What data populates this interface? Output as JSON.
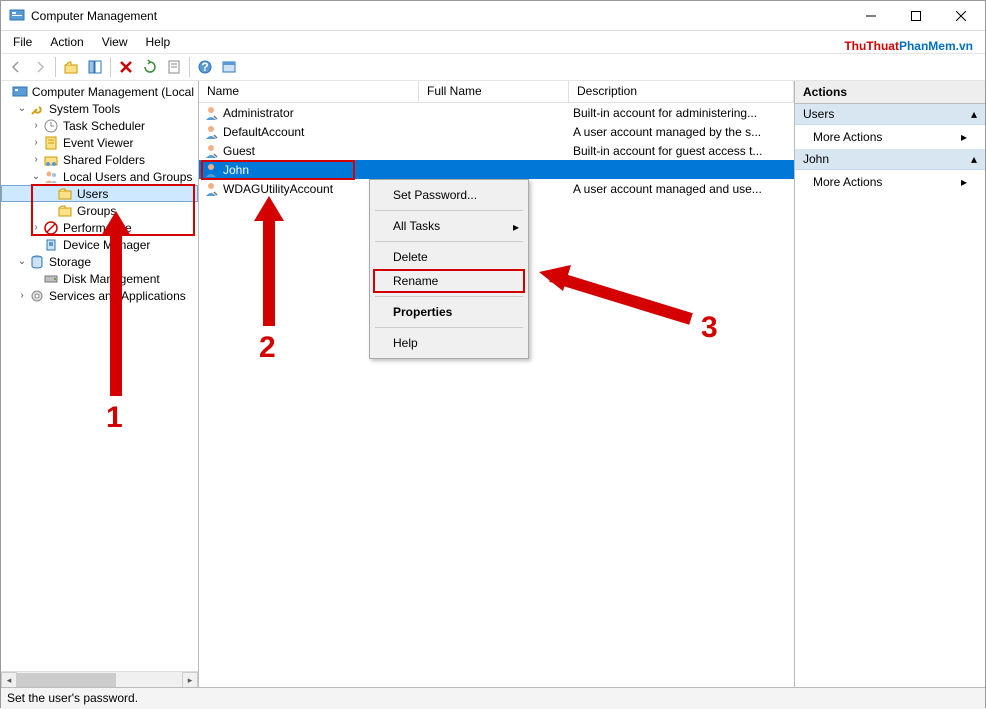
{
  "title": "Computer Management",
  "menus": [
    "File",
    "Action",
    "View",
    "Help"
  ],
  "watermark": {
    "part1": "ThuThuat",
    "part2": "PhanMem",
    "part3": ".vn"
  },
  "tree": {
    "root": "Computer Management (Local",
    "system_tools": "System Tools",
    "task_scheduler": "Task Scheduler",
    "event_viewer": "Event Viewer",
    "shared_folders": "Shared Folders",
    "local_users_groups": "Local Users and Groups",
    "users": "Users",
    "groups": "Groups",
    "performance": "Performance",
    "device_manager": "Device Manager",
    "storage": "Storage",
    "disk_management": "Disk Management",
    "services_apps": "Services and Applications"
  },
  "columns": {
    "name": "Name",
    "fullname": "Full Name",
    "description": "Description"
  },
  "users": [
    {
      "name": "Administrator",
      "fullname": "",
      "desc": "Built-in account for administering..."
    },
    {
      "name": "DefaultAccount",
      "fullname": "",
      "desc": "A user account managed by the s..."
    },
    {
      "name": "Guest",
      "fullname": "",
      "desc": "Built-in account for guest access t..."
    },
    {
      "name": "John",
      "fullname": "",
      "desc": ""
    },
    {
      "name": "WDAGUtilityAccount",
      "fullname": "",
      "desc": "A user account managed and use..."
    }
  ],
  "context_menu": {
    "set_password": "Set Password...",
    "all_tasks": "All Tasks",
    "delete": "Delete",
    "rename": "Rename",
    "properties": "Properties",
    "help": "Help"
  },
  "actions": {
    "header": "Actions",
    "section_users": "Users",
    "section_john": "John",
    "more_actions": "More Actions"
  },
  "statusbar": "Set the user's password.",
  "annotations": {
    "n1": "1",
    "n2": "2",
    "n3": "3"
  }
}
